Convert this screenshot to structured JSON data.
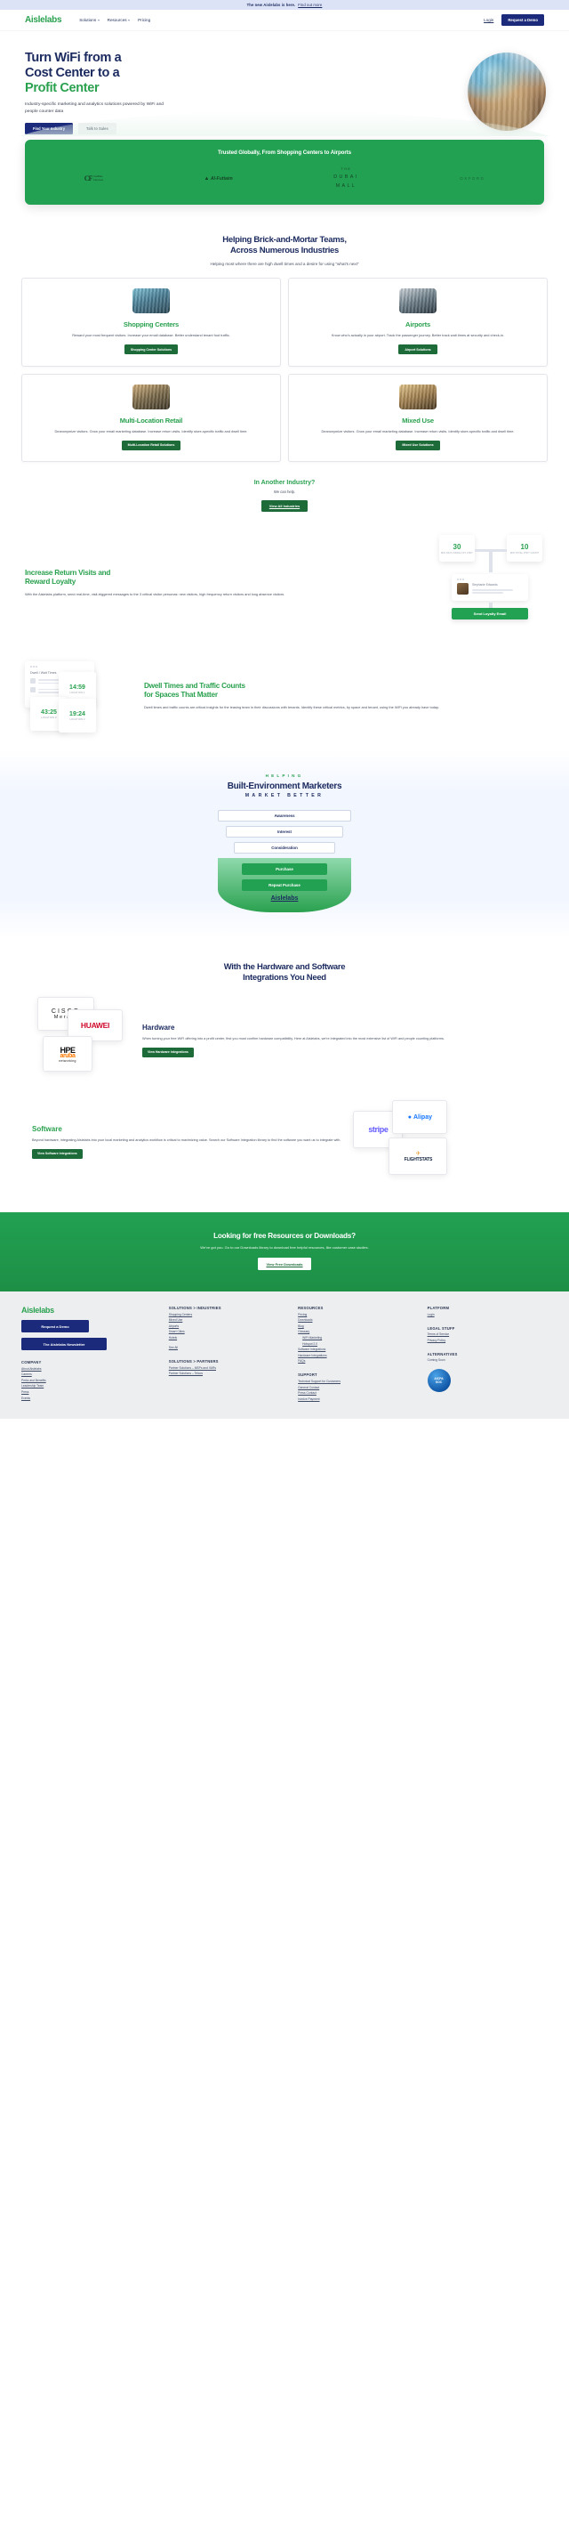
{
  "announce": {
    "text": "The new Aislelabs is here.",
    "link": "Find out more"
  },
  "nav": {
    "logo": "Aislelabs",
    "links": [
      {
        "label": "Solutions",
        "caret": true
      },
      {
        "label": "Resources",
        "caret": true
      },
      {
        "label": "Pricing",
        "caret": false
      }
    ],
    "login": "Login",
    "demo": "Request a Demo"
  },
  "hero": {
    "title_line1": "Turn WiFi from a",
    "title_line2": "Cost Center to a",
    "title_line3": "Profit Center",
    "subtitle": "Industry-specific marketing and analytics solutions powered by WiFi and people counter data",
    "btn_primary": "Find Your Industry",
    "btn_secondary": "Talk to Sales"
  },
  "trust": {
    "heading": "Trusted Globally, From Shopping Centers to Airports",
    "logos": [
      {
        "name": "Cadillac Fairview",
        "mark": "CF",
        "sub1": "Cadillac",
        "sub2": "Fairview"
      },
      {
        "name": "Al-Futtaim",
        "mark": "Al-Futtaim"
      },
      {
        "name": "The Dubai Mall",
        "l1": "THE",
        "l2": "DUBAI",
        "l3": "MALL"
      },
      {
        "name": "Oxford",
        "mark": "OXFORD"
      }
    ]
  },
  "industries": {
    "title_line1": "Helping Brick-and-Mortar Teams,",
    "title_line2": "Across Numerous Industries",
    "subtitle": "Helping most where there are high dwell times and a desire for using \"what's next\"",
    "cards": [
      {
        "title": "Shopping Centers",
        "body": "Reward your most frequent visitors. Increase your email database. Better understand tenant foot traffic.",
        "button": "Shopping Center Solutions"
      },
      {
        "title": "Airports",
        "body": "Know who's actually in your airport. Track the passenger journey. Better track wait times at security and check-in.",
        "button": "Airport Solutions"
      },
      {
        "title": "Multi-Location Retail",
        "body": "Deanonymize visitors. Grow your email marketing database. Increase return visits. Identify store-specific traffic and dwell time.",
        "button": "Multi-Location Retail Solutions"
      },
      {
        "title": "Mixed Use",
        "body": "Deanonymize visitors. Grow your email marketing database. Increase return visits. Identify store-specific traffic and dwell time.",
        "button": "Mixed Use Solutions"
      }
    ],
    "another_title": "In Another Industry?",
    "another_sub": "We can help.",
    "another_btn": "View All Industries"
  },
  "loyalty": {
    "title_line1": "Increase Return Visits and",
    "title_line2": "Reward Loyalty",
    "body": "With the Aislelabs platform, send real-time, visit-triggered messages to the 3 critical visitor personas: new visitors, high frequency return visitors and long absence visitors.",
    "stat1_value": "30",
    "stat1_label": "MIN DAYS SINCE 1ST VISIT",
    "stat2_value": "10",
    "stat2_label": "MIN TOTAL VISIT COUNT",
    "person": "Stephanie Edwards",
    "cta": "Send Loyalty Email"
  },
  "dwell": {
    "title_line1": "Dwell Times and Traffic Counts",
    "title_line2": "for Spaces That Matter",
    "body": "Dwell times and traffic counts are critical insights for the leasing team in their discussions with tenants. Identify these critical metrics, by space and tenant, using the WiFi you already have today.",
    "panel_label": "Dwell / Wait Times",
    "tiles": [
      {
        "value": "14:59",
        "label": "LOCATION 1"
      },
      {
        "value": "43:25",
        "label": "LOCATION 3"
      },
      {
        "value": "19:24",
        "label": "LOCATION 2"
      }
    ]
  },
  "funnel": {
    "eyebrow": "HELPING",
    "title": "Built-Environment Marketers",
    "subtitle": "MARKET BETTER",
    "steps": [
      "Awareness",
      "Interest",
      "Consideration"
    ],
    "green_steps": [
      "Purchase",
      "Repeat Purchase"
    ],
    "logo": "Aislelabs"
  },
  "integrations": {
    "title_line1": "With the Hardware and Software",
    "title_line2": "Integrations You Need",
    "hardware": {
      "title": "Hardware",
      "body": "When turning your free WiFi offering into a profit center, first you must confirm hardware compatibility. Here at Aislelabs, we're integrated into the most extensive list of WiFi and people counting platforms.",
      "button": "View Hardware Integrations",
      "logos": [
        "CISCO Meraki",
        "HUAWEI",
        "HPE aruba networking"
      ]
    },
    "software": {
      "title": "Software",
      "body": "Beyond hardware, integrating Aislelabs into your local marketing and analytics workflow is critical to maximizing value. Search our Software Integration library to find the software you want us to integrate with.",
      "button": "View Software Integrations",
      "logos": [
        "stripe",
        "Alipay",
        "FLIGHTSTATS"
      ]
    }
  },
  "cta": {
    "title": "Looking for free Resources or Downloads?",
    "body": "We've got you. Go to our Downloads library to download free helpful resources, like customer case studies.",
    "button": "View Free Downloads"
  },
  "footer": {
    "logo": "Aislelabs",
    "btn_demo": "Request a Demo",
    "btn_newsletter": "The Aislelabs Newsletter",
    "columns": [
      {
        "heading": "COMPANY",
        "links": [
          "About Aislelabs",
          "Careers",
          "Perks and Benefits",
          "Leadership Team",
          "Press",
          "Events"
        ]
      },
      {
        "heading": "SOLUTIONS > INDUSTRIES",
        "links": [
          "Shopping Centers",
          "Mixed Use",
          "Airports",
          "Smart Cities",
          "Hotels"
        ],
        "see_all": "See All",
        "heading2": "SOLUTIONS > PARTNERS",
        "links2": [
          "Partner Solutions – MSPs and VARs",
          "Partner Solutions – Telcos"
        ]
      },
      {
        "heading": "RESOURCES",
        "links": [
          "Pricing",
          "Downloads",
          "Blog",
          "Glossary"
        ],
        "indented": [
          "WiFi Marketing",
          "Hotspot 2.0"
        ],
        "links_after": [
          "Software Integrations",
          "Hardware Integrations",
          "FAQs"
        ],
        "heading2": "SUPPORT",
        "links2": [
          "Technical Support for Customers",
          "General Contact",
          "Press Contact",
          "Invoice Payment"
        ]
      },
      {
        "heading": "PLATFORM",
        "links": [
          "Login"
        ],
        "heading2": "LEGAL STUFF",
        "links2": [
          "Terms of Service",
          "Privacy Policy"
        ],
        "heading3": "ALTERNATIVES",
        "plain": [
          "Coming Soon"
        ],
        "badge_l1": "AICPA",
        "badge_l2": "SOC"
      }
    ]
  }
}
